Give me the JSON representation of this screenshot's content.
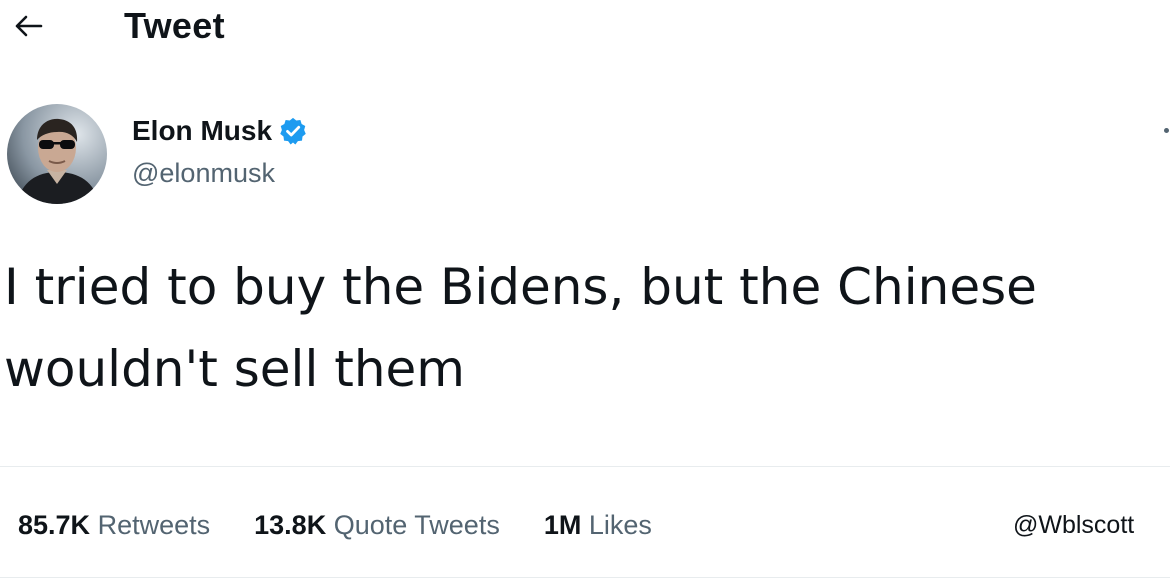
{
  "header": {
    "title": "Tweet",
    "back_icon": "arrow-left-icon"
  },
  "author": {
    "name": "Elon Musk",
    "handle": "@elonmusk",
    "verified": true,
    "verified_color": "#1d9bf0"
  },
  "tweet": {
    "text": "I tried to buy the Bidens, but the Chinese\nwouldn't sell them"
  },
  "stats": [
    {
      "count": "85.7K",
      "label": "Retweets"
    },
    {
      "count": "13.8K",
      "label": "Quote Tweets"
    },
    {
      "count": "1M",
      "label": "Likes"
    }
  ],
  "watermark": "@Wblscott",
  "colors": {
    "text": "#0f1419",
    "secondary": "#536471",
    "divider": "#e8ecee"
  }
}
